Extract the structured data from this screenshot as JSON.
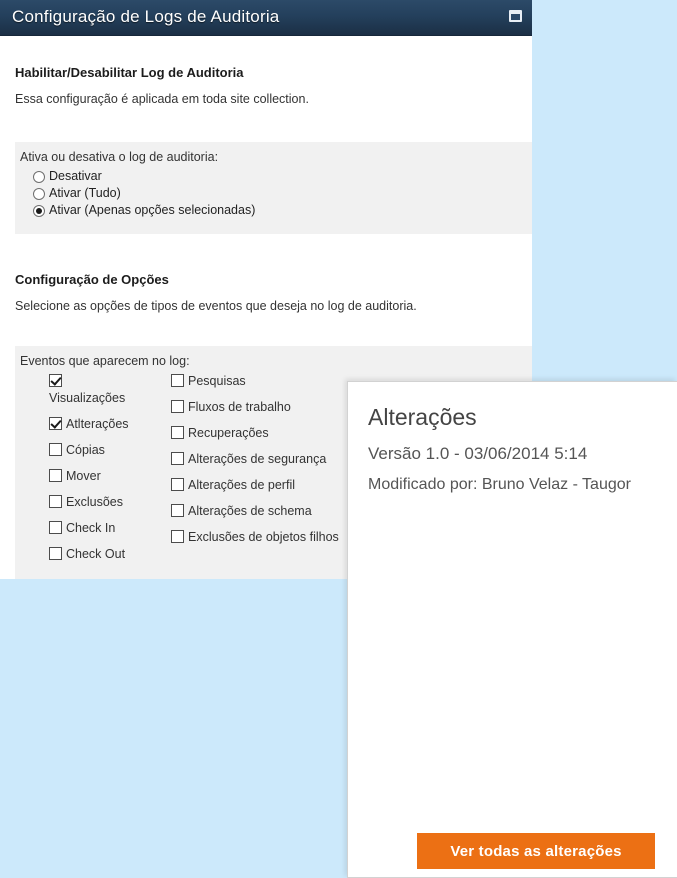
{
  "window": {
    "title": "Configuração de Logs de Auditoria",
    "restore_icon": "restore-window-icon"
  },
  "enable_section": {
    "heading": "Habilitar/Desabilitar Log de Auditoria",
    "description": "Essa configuração é aplicada em toda site collection.",
    "radio_label": "Ativa ou desativa o log de auditoria:",
    "options": [
      {
        "label": "Desativar",
        "selected": false
      },
      {
        "label": "Ativar (Tudo)",
        "selected": false
      },
      {
        "label": "Ativar (Apenas opções selecionadas)",
        "selected": true
      }
    ]
  },
  "options_section": {
    "heading": "Configuração de Opções",
    "description": "Selecione as opções de tipos de eventos que deseja no log de auditoria.",
    "events_label": "Eventos que aparecem no log:",
    "left_column": [
      {
        "label": "Visualizações",
        "checked": true,
        "wrap": true
      },
      {
        "label": "Atlterações",
        "checked": true
      },
      {
        "label": "Cópias",
        "checked": false
      },
      {
        "label": "Mover",
        "checked": false
      },
      {
        "label": "Exclusões",
        "checked": false
      },
      {
        "label": "Check In",
        "checked": false
      },
      {
        "label": "Check Out",
        "checked": false
      }
    ],
    "right_column": [
      {
        "label": "Pesquisas",
        "checked": false
      },
      {
        "label": "Fluxos de trabalho",
        "checked": false
      },
      {
        "label": "Recuperações",
        "checked": false
      },
      {
        "label": "Alterações de segurança",
        "checked": false
      },
      {
        "label": "Alterações de perfil",
        "checked": false
      },
      {
        "label": "Alterações de schema",
        "checked": false
      },
      {
        "label": "Exclusões de objetos filhos",
        "checked": false
      }
    ]
  },
  "changes_panel": {
    "title": "Alterações",
    "version": "Versão 1.0 - 03/06/2014 5:14",
    "modified_by": "Modificado por: Bruno Velaz - Taugor",
    "button_label": "Ver todas as alterações"
  },
  "colors": {
    "page_background": "#cce9fb",
    "titlebar": "#24405c",
    "panel_grey": "#f1f1f1",
    "accent_orange": "#ec7014"
  }
}
